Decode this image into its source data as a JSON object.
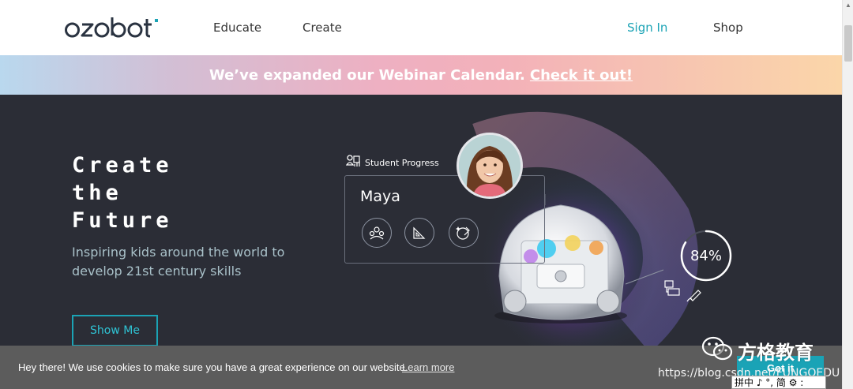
{
  "header": {
    "logo_alt": "ozobot",
    "nav": {
      "educate": "Educate",
      "create": "Create",
      "sign_in": "Sign In",
      "shop": "Shop"
    }
  },
  "banner": {
    "text": "We’ve expanded our Webinar Calendar.",
    "link": "Check it out!"
  },
  "hero": {
    "title_lines": [
      "Create",
      "the",
      "Future"
    ],
    "subtitle": "Inspiring kids around the world to develop 21st century skills",
    "cta": "Show Me"
  },
  "illustration": {
    "progress_label": "Student Progress",
    "student_name": "Maya",
    "percent_text": "84%",
    "percent_value": 0.84,
    "icons": [
      "collaboration-icon",
      "geometry-icon",
      "creativity-icon"
    ]
  },
  "cookie": {
    "text": "Hey there! We use cookies to make sure you have a great experience on our website.",
    "link": "Learn more",
    "button": "Got it"
  },
  "watermark": {
    "brand": "方格教育",
    "url": "https://blog.csdn.net/FUNGOEDU"
  },
  "ime": {
    "text": "拼中 ♪ °, 简 ⚙ :"
  },
  "colors": {
    "accent": "#1ba3b5",
    "hero_bg": "#2b2d36",
    "cookie_bg": "#505050"
  }
}
